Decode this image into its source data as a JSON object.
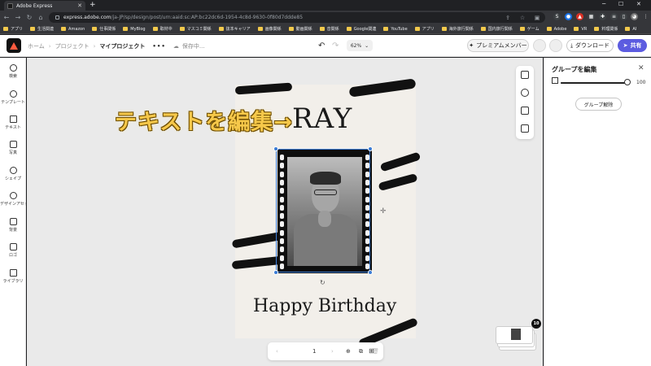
{
  "browser": {
    "tab_title": "Adobe Express",
    "url_host": "express.adobe.com",
    "url_path": "/ja-JP/sp/design/post/urn:aaid:sc:AP:bc22dc6d-1954-4c8d-9630-0f80d7ddde85",
    "bookmarks": [
      "アプリ",
      "生活関連",
      "Amazon",
      "仕事関係",
      "MyBlog",
      "取材中",
      "マスコミ関係",
      "抜本キャリア",
      "画像関係",
      "動画関係",
      "音関係",
      "Google関連",
      "YouTube",
      "アプリ",
      "海外旅行関係",
      "国内旅行関係",
      "ゲーム",
      "Adobe",
      "VR",
      "料理関係",
      "AI"
    ]
  },
  "header": {
    "breadcrumb": [
      "ホーム",
      "プロジェクト",
      "マイプロジェクト"
    ],
    "more_label": "•••",
    "save_status": "保存中...",
    "zoom": "62%",
    "premium_label": "プレミアムメンバー",
    "download_label": "ダウンロード",
    "share_label": "共有"
  },
  "leftrail": {
    "items": [
      "検索",
      "テンプレート",
      "テキスト",
      "写真",
      "シェイプ",
      "デザインアセット",
      "背景",
      "ロゴ",
      "ライブラリ"
    ]
  },
  "canvas": {
    "overlay_text": "テキストを編集→",
    "title_text": "RAY",
    "greeting_text": "Happy Birthday",
    "page_number": "1",
    "page_count_badge": "10"
  },
  "rightpanel": {
    "title": "グループを編集",
    "opacity_value": "100",
    "opacity_fraction": 1.0,
    "ungroup_label": "グループ解除"
  },
  "colors": {
    "accent": "#5c5ce0",
    "selection": "#3a7bd5",
    "brand": "#ff5b3f"
  }
}
